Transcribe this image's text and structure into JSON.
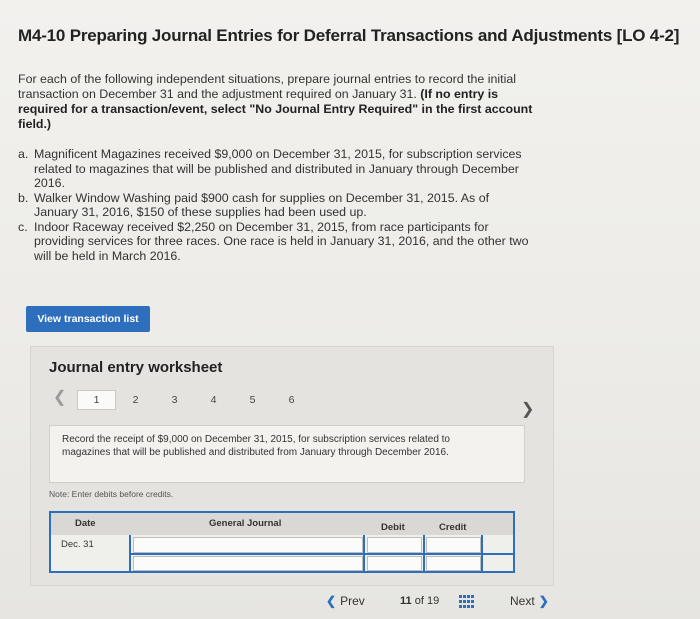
{
  "header": {
    "title": "M4-10 Preparing Journal Entries for Deferral Transactions and Adjustments [LO 4-2]"
  },
  "intro": {
    "text": "For each of the following independent situations, prepare journal entries to record the initial transaction on December 31 and the adjustment required on January 31. ",
    "bold_text": "(If no entry is required for a transaction/event, select \"No Journal Entry Required\" in the first account field.)"
  },
  "situations": [
    {
      "label": "a.",
      "text": "Magnificent Magazines received $9,000 on December 31, 2015, for subscription services related to magazines that will be published and distributed in January through December 2016."
    },
    {
      "label": "b.",
      "text": "Walker Window Washing paid $900 cash for supplies on December 31, 2015. As of January 31, 2016, $150 of these supplies had been used up."
    },
    {
      "label": "c.",
      "text": "Indoor Raceway received $2,250 on December 31, 2015, from race participants for providing services for three races. One race is held in January 31, 2016, and the other two will be held in March 2016."
    }
  ],
  "buttons": {
    "view_transaction_list": "View transaction list"
  },
  "worksheet": {
    "title": "Journal entry worksheet",
    "tabs": [
      "1",
      "2",
      "3",
      "4",
      "5",
      "6"
    ],
    "active_tab": "1",
    "description": "Record the receipt of $9,000 on December 31, 2015, for subscription services related to magazines that will be published and distributed from January through December 2016.",
    "note": "Note: Enter debits before credits.",
    "table": {
      "headers": {
        "date": "Date",
        "general_journal": "General Journal",
        "debit": "Debit",
        "credit": "Credit"
      },
      "rows": [
        {
          "date": "Dec. 31"
        }
      ]
    }
  },
  "pagination": {
    "prev_label": "Prev",
    "current": "11",
    "of_label": "of",
    "total": "19",
    "next_label": "Next"
  },
  "colors": {
    "accent": "#2d6fbd",
    "background": "#eceae6"
  }
}
